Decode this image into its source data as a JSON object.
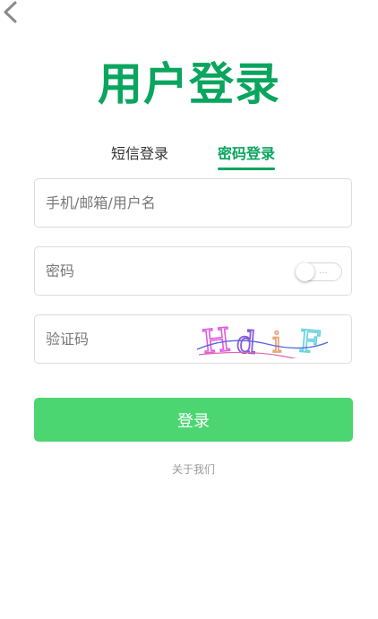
{
  "page": {
    "title": "用户登录"
  },
  "tabs": [
    {
      "label": "短信登录",
      "active": false
    },
    {
      "label": "密码登录",
      "active": true
    }
  ],
  "form": {
    "account_placeholder": "手机/邮箱/用户名",
    "account_value": "",
    "password_placeholder": "密码",
    "password_value": "",
    "password_toggle_text": "...",
    "captcha_placeholder": "验证码",
    "captcha_value": "",
    "captcha_chars": [
      "H",
      "d",
      "i",
      "F"
    ],
    "submit_label": "登录"
  },
  "footer": {
    "about_label": "关于我们"
  },
  "icons": {
    "back": "chevron-left-icon"
  },
  "colors": {
    "brand_green": "#0aa55e",
    "button_green": "#4cd672",
    "input_border": "#dcdcdc",
    "text_muted": "#999999"
  }
}
